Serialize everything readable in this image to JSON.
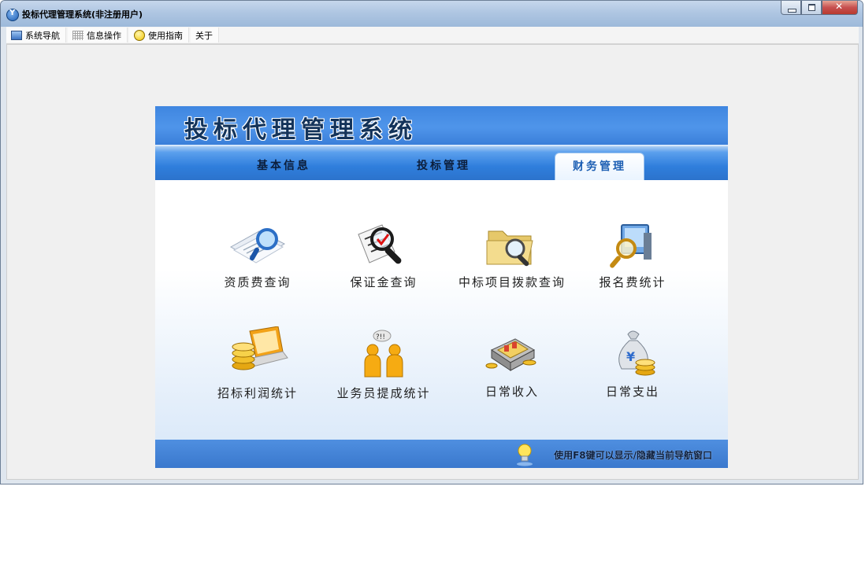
{
  "window": {
    "title": "投标代理管理系统(非注册用户)"
  },
  "menu": {
    "items": [
      {
        "label": "系统导航",
        "icon": "nav-window-icon"
      },
      {
        "label": "信息操作",
        "icon": "grid-icon"
      },
      {
        "label": "使用指南",
        "icon": "guide-icon"
      },
      {
        "label": "关于",
        "icon": ""
      }
    ]
  },
  "panel": {
    "title": "投标代理管理系统",
    "tabs": [
      {
        "label": "基本信息",
        "active": false
      },
      {
        "label": "投标管理",
        "active": false
      },
      {
        "label": "财务管理",
        "active": true
      }
    ],
    "items": [
      {
        "label": "资质费查询",
        "icon": "document-magnifier-icon"
      },
      {
        "label": "保证金查询",
        "icon": "checklist-magnifier-icon"
      },
      {
        "label": "中标项目拨款查询",
        "icon": "folder-magnifier-icon"
      },
      {
        "label": "报名费统计",
        "icon": "computer-magnifier-icon"
      },
      {
        "label": "招标利润统计",
        "icon": "laptop-coins-icon"
      },
      {
        "label": "业务员提成统计",
        "icon": "people-question-icon"
      },
      {
        "label": "日常收入",
        "icon": "cash-box-icon"
      },
      {
        "label": "日常支出",
        "icon": "money-bag-icon"
      }
    ],
    "speech_bubble": "?!!",
    "hint": "使用F8键可以显示/隐藏当前导航窗口"
  },
  "colors": {
    "panel_blue": "#3f86e0",
    "active_tab_text": "#1d5fb3"
  }
}
